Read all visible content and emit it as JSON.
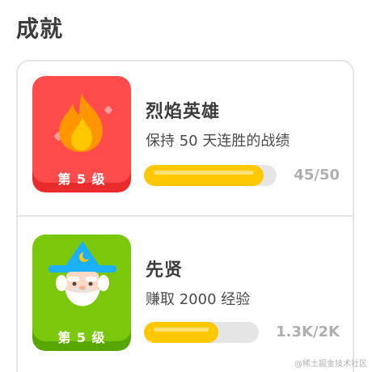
{
  "section": {
    "title": "成就"
  },
  "achievements": [
    {
      "title": "烈焰英雄",
      "description": "保持 50 天连胜的战绩",
      "level": "第 5 级",
      "progress_text": "45/50",
      "progress": 0.9,
      "icon": "flame-icon",
      "badge_color": "#ff4b4b",
      "badge_shade": "#ea2b2b"
    },
    {
      "title": "先贤",
      "description": "赚取 2000 经验",
      "level": "第 5 级",
      "progress_text": "1.3K/2K",
      "progress": 0.65,
      "icon": "wizard-icon",
      "badge_color": "#7ac70c",
      "badge_shade": "#58a700"
    }
  ],
  "colors": {
    "progress_fill": "#ffc800",
    "progress_track": "#e5e5e5",
    "title_text": "#3c3c3c"
  },
  "watermark": "@稀土掘金技术社区"
}
